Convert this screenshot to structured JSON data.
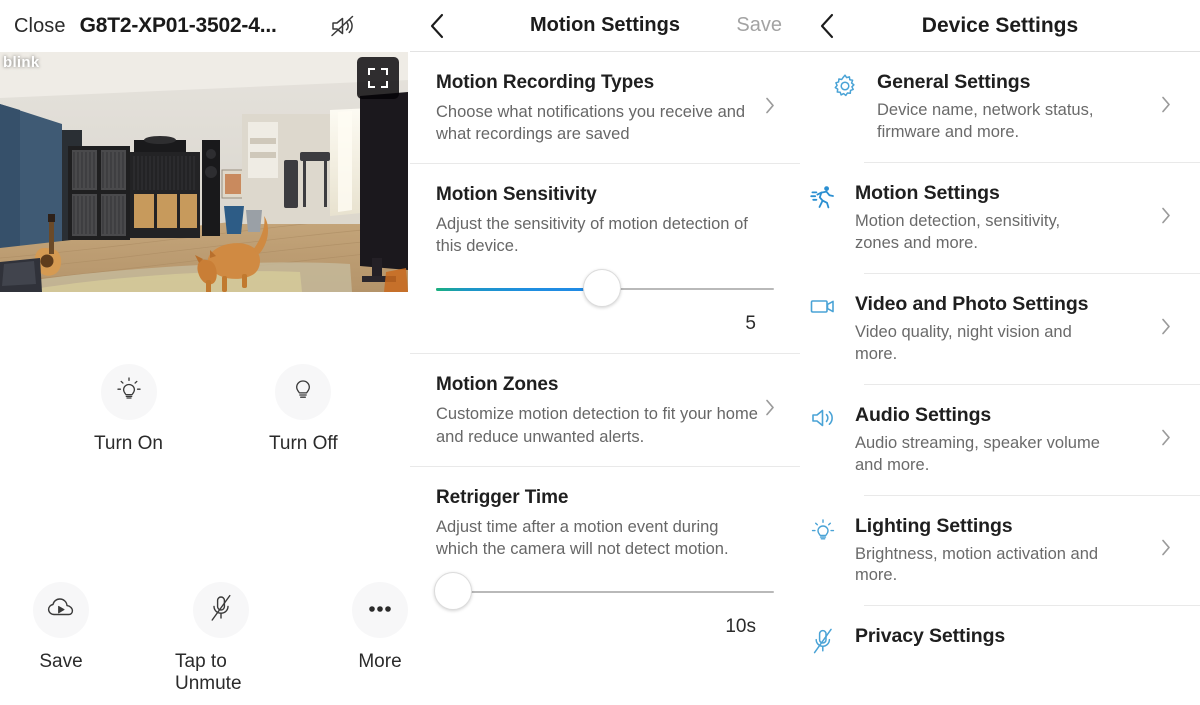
{
  "left_panel": {
    "close_label": "Close",
    "device_id": "G8T2-XP01-3502-4...",
    "mute_icon": "speaker-muted-icon",
    "video": {
      "watermark": "blink",
      "fullscreen_icon": "fullscreen-icon"
    },
    "light_controls": [
      {
        "icon": "light-bulb-on-icon",
        "label": "Turn On"
      },
      {
        "icon": "light-bulb-off-icon",
        "label": "Turn Off"
      }
    ],
    "action_controls": [
      {
        "icon": "cloud-save-icon",
        "label": "Save"
      },
      {
        "icon": "microphone-muted-icon",
        "label": "Tap to Unmute"
      },
      {
        "icon": "more-ellipsis-icon",
        "label": "More"
      }
    ]
  },
  "middle_panel": {
    "back_icon": "back-chevron-icon",
    "title": "Motion Settings",
    "save_label": "Save",
    "sections": [
      {
        "title": "Motion Recording Types",
        "desc": "Choose what notifications you receive and what recordings are saved",
        "has_chevron": true
      },
      {
        "title": "Motion Sensitivity",
        "desc": "Adjust the sensitivity of motion detection of this device.",
        "has_chevron": false,
        "slider": {
          "value": "5",
          "percent": 49,
          "fill": true
        }
      },
      {
        "title": "Motion Zones",
        "desc": "Customize motion detection to fit your home and reduce unwanted alerts.",
        "has_chevron": true
      },
      {
        "title": "Retrigger Time",
        "desc": "Adjust time after a motion event during which the camera will not detect motion.",
        "has_chevron": false,
        "slider": {
          "value": "10s",
          "percent": 5,
          "fill": false
        }
      }
    ]
  },
  "right_panel": {
    "back_icon": "back-chevron-icon",
    "title": "Device Settings",
    "items": [
      {
        "icon": "gear-icon",
        "title": "General Settings",
        "desc": "Device name, network status, firmware and more."
      },
      {
        "icon": "running-person-icon",
        "title": "Motion Settings",
        "desc": "Motion detection, sensitivity, zones and more."
      },
      {
        "icon": "video-camera-icon",
        "title": "Video and Photo Settings",
        "desc": "Video quality, night vision and more."
      },
      {
        "icon": "speaker-icon",
        "title": "Audio Settings",
        "desc": "Audio streaming, speaker volume and more."
      },
      {
        "icon": "light-bulb-icon",
        "title": "Lighting Settings",
        "desc": "Brightness, motion activation and more."
      },
      {
        "icon": "microphone-muted-icon",
        "title": "Privacy Settings",
        "desc": ""
      }
    ]
  },
  "colors": {
    "accent_blue": "#3C9FD6",
    "slider_blue": "#2189e6",
    "slider_green": "#19b07d",
    "text_primary": "#1f1f1f",
    "text_secondary": "#6a6a6a",
    "disabled": "#a3a3a3"
  }
}
